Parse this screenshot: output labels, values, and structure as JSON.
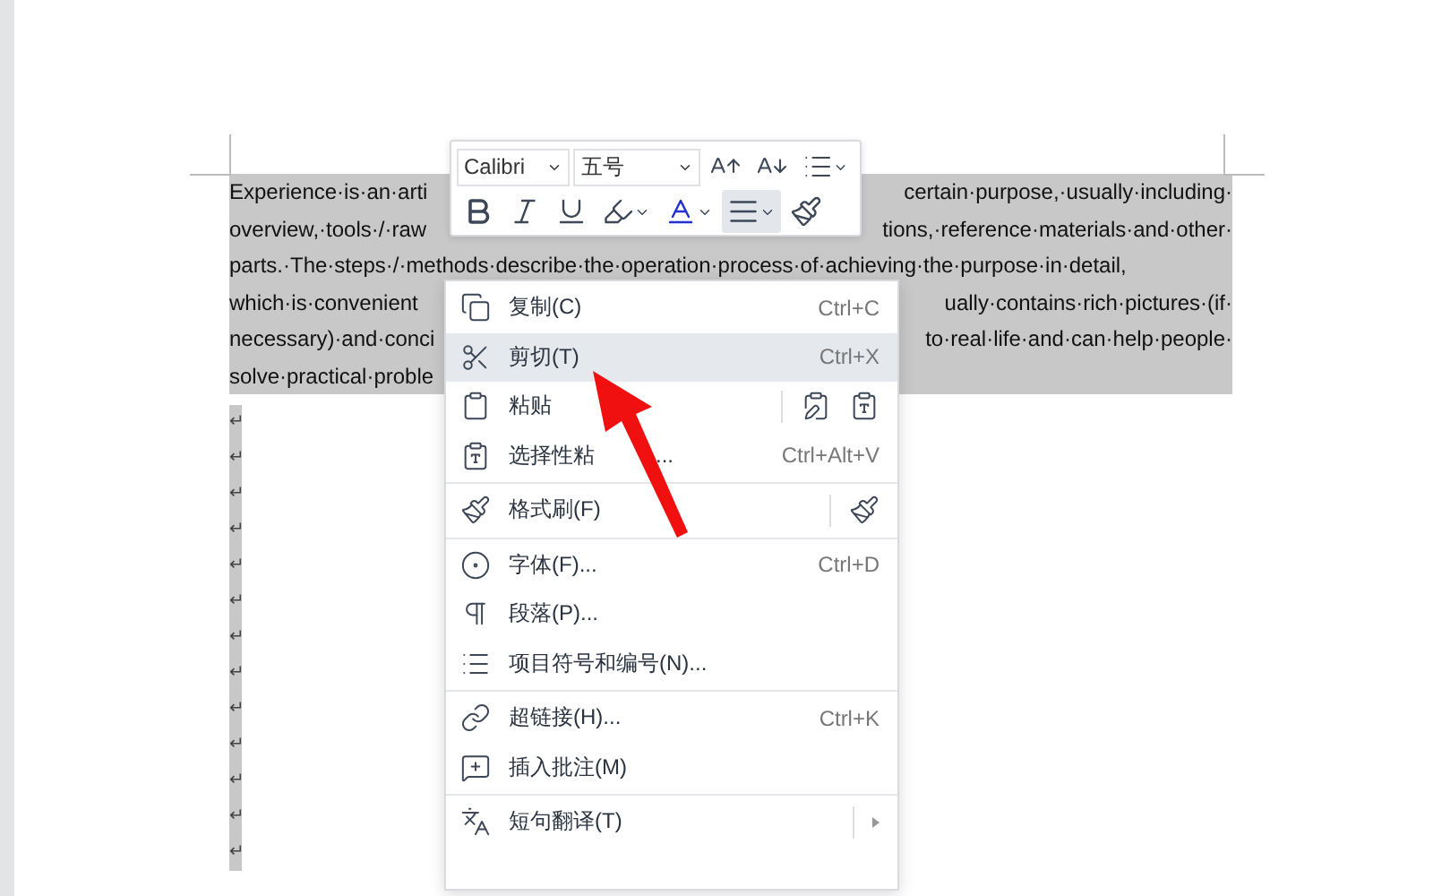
{
  "document": {
    "lines": [
      {
        "parts": [
          "Experience·is·an·arti",
          "certain·purpose,·usually·including·"
        ]
      },
      {
        "parts": [
          "overview,·tools·/·raw",
          "tions,·reference·materials·and·other·"
        ]
      },
      {
        "parts": [
          "parts.·The·steps·/·methods·describe·the·operation·process·of·achieving·the·purpose·in·detail,"
        ]
      },
      {
        "parts": [
          "which·is·convenient",
          "ually·contains·rich·pictures·(if·"
        ]
      },
      {
        "parts": [
          "necessary)·and·conci",
          "to·real·life·and·can·help·people·"
        ]
      },
      {
        "parts": [
          "solve·practical·proble"
        ]
      }
    ],
    "paragraph_marks": [
      "↵",
      "↵",
      "↵",
      "↵",
      "↵",
      "↵",
      "↵",
      "↵",
      "↵",
      "↵",
      "↵",
      "↵",
      "↵"
    ],
    "selected": true
  },
  "toolbar": {
    "font": "Calibri",
    "size": "五号",
    "buttons": [
      {
        "selected": false
      },
      {
        "selected": false
      },
      {
        "selected": false
      },
      {
        "selected": false
      },
      {
        "selected": false
      },
      {
        "selected": true
      },
      {
        "selected": false
      }
    ]
  },
  "context_menu": {
    "groups": [
      [
        {
          "label": "复制(C)",
          "shortcut": "Ctrl+C",
          "highlighted": false
        },
        {
          "label": "剪切(T)",
          "shortcut": "Ctrl+X",
          "highlighted": true
        },
        {
          "label": "粘贴",
          "highlighted": false
        },
        {
          "label": "选择性粘",
          "label_tail": "...",
          "shortcut": "Ctrl+Alt+V",
          "highlighted": false
        }
      ],
      [
        {
          "label": "格式刷(F)",
          "highlighted": false
        }
      ],
      [
        {
          "label": "字体(F)...",
          "shortcut": "Ctrl+D",
          "highlighted": false
        },
        {
          "label": "段落(P)...",
          "highlighted": false
        },
        {
          "label": "项目符号和编号(N)...",
          "highlighted": false
        }
      ],
      [
        {
          "label": "超链接(H)...",
          "shortcut": "Ctrl+K",
          "highlighted": false
        },
        {
          "label": "插入批注(M)",
          "highlighted": false
        }
      ],
      [
        {
          "label": "短句翻译(T)",
          "highlighted": false
        }
      ]
    ]
  }
}
